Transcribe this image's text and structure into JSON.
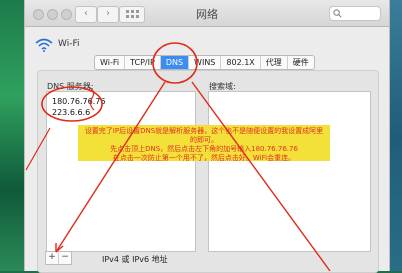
{
  "window": {
    "title": "网络",
    "search_placeholder": ""
  },
  "titlebar": {
    "back_label": "‹",
    "forward_label": "›"
  },
  "wifi": {
    "label": "Wi-Fi"
  },
  "tabs": [
    {
      "label": "Wi-Fi",
      "active": false
    },
    {
      "label": "TCP/IP",
      "active": false
    },
    {
      "label": "DNS",
      "active": true
    },
    {
      "label": "WINS",
      "active": false
    },
    {
      "label": "802.1X",
      "active": false
    },
    {
      "label": "代理",
      "active": false
    },
    {
      "label": "硬件",
      "active": false
    }
  ],
  "dns": {
    "servers_label": "DNS 服务器:",
    "servers": [
      "180.76.76.76",
      "223.6.6.6"
    ],
    "search_domains_label": "搜索域:"
  },
  "bottom": {
    "add_label": "+",
    "remove_label": "−",
    "ipv_label": "IPv4 或 IPv6 地址"
  },
  "note": {
    "lines": [
      "设置完了IP后设置DNS就是解析服务器，这个也不是随便设置的我设置成阿里",
      "的即可。",
      "先点击顶上DNS，然后点击左下角的加号输入180.76.76.76",
      "在点击一次防止第一个用不了，然后点击好。WiFi会重连。"
    ]
  },
  "colors": {
    "tab_active": "#3c8cf4",
    "note_bg": "#f3df2e",
    "note_text": "#e0261b",
    "annotation": "#e02a1a"
  }
}
